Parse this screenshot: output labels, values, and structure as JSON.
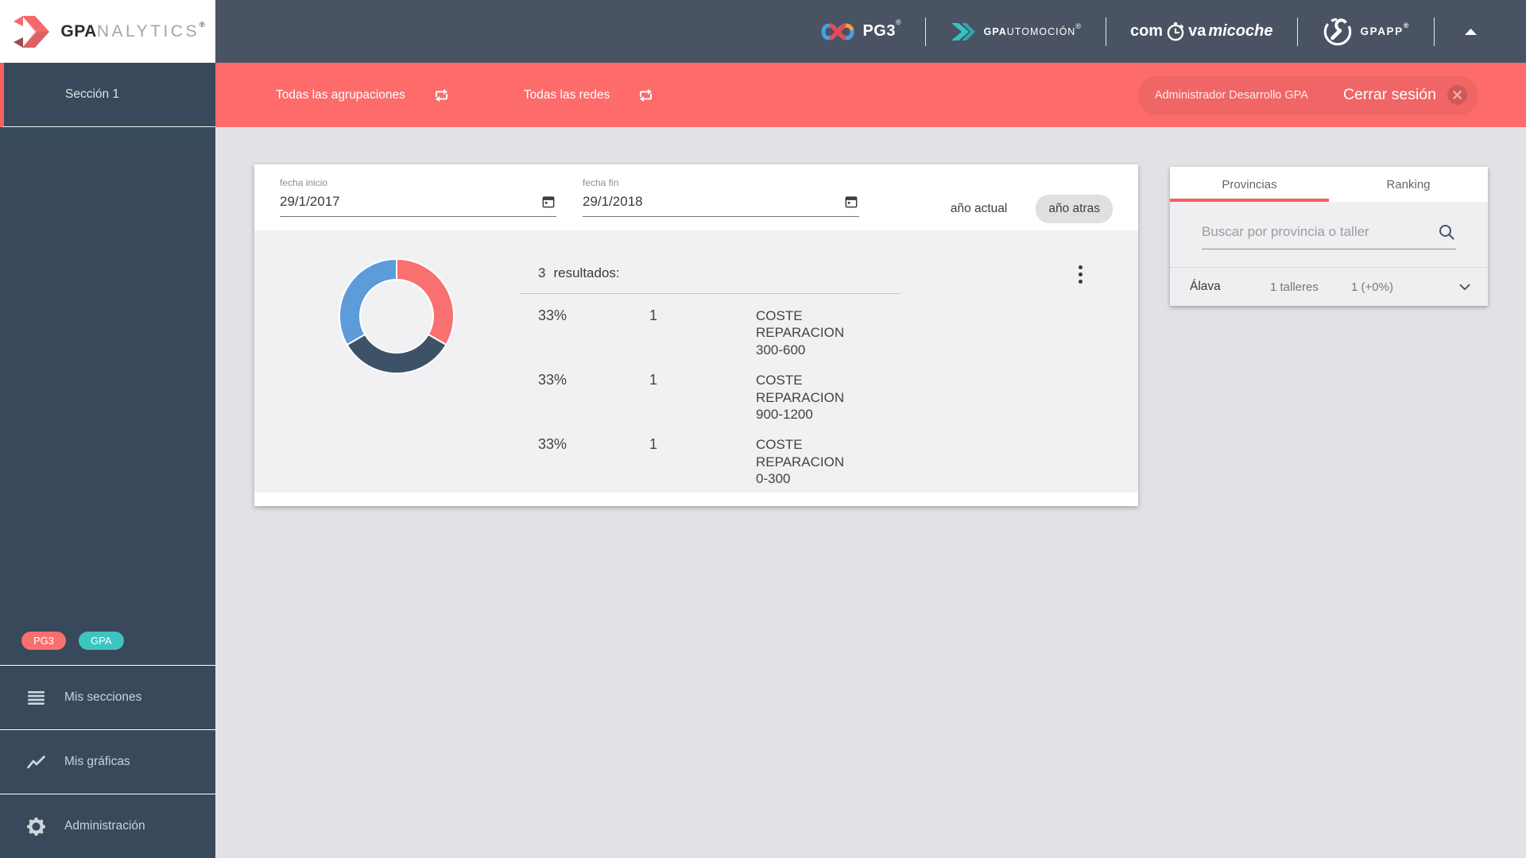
{
  "colors": {
    "accent_red": "#fe6b6b",
    "teal": "#3ec4c0",
    "header_bg": "#4a5363",
    "sidebar_bg": "#37495a",
    "tab_underline": "#f55f60"
  },
  "header": {
    "brand": {
      "gpa": "GPA",
      "nalytics": "NALYTICS",
      "reg": "®"
    },
    "pg3": {
      "label": "PG3",
      "reg": "®"
    },
    "gpautomocion": {
      "gpa": "GPA",
      "rest": "UTOMOCIÓN",
      "reg": "®"
    },
    "compravamicoche": {
      "part1": "com",
      "part2": "va",
      "part3": "micoche"
    },
    "gpapp": {
      "label": "GPAPP",
      "reg": "®"
    }
  },
  "sidebar": {
    "section": "Sección 1",
    "badges": [
      {
        "label": "PG3"
      },
      {
        "label": "GPA"
      }
    ],
    "items": [
      {
        "label": "Mis secciones"
      },
      {
        "label": "Mis gráficas"
      },
      {
        "label": "Administración"
      }
    ]
  },
  "toolbar": {
    "filters": [
      {
        "label": "Todas las agrupaciones"
      },
      {
        "label": "Todas las redes"
      }
    ],
    "user": "Administrador Desarrollo GPA",
    "logout": "Cerrar sesión"
  },
  "card": {
    "date_start": {
      "label": "fecha inicio",
      "value": "29/1/2017"
    },
    "date_end": {
      "label": "fecha fin",
      "value": "29/1/2018"
    },
    "year_current": "año actual",
    "year_back": "año atras",
    "results_count": "3",
    "results_label": "resultados:",
    "rows": [
      {
        "percent": "33%",
        "count": "1",
        "label": "COSTE REPARACION 300-600"
      },
      {
        "percent": "33%",
        "count": "1",
        "label": "COSTE REPARACION 900-1200"
      },
      {
        "percent": "33%",
        "count": "1",
        "label": "COSTE REPARACION 0-300"
      }
    ]
  },
  "panel": {
    "tabs": [
      {
        "label": "Provincias"
      },
      {
        "label": "Ranking"
      }
    ],
    "search_placeholder": "Buscar por provincia o taller",
    "rows": [
      {
        "name": "Álava",
        "talleres": "1 talleres",
        "value": "1 (+0%)"
      }
    ]
  },
  "chart_data": {
    "type": "pie",
    "donut": true,
    "title": "",
    "labels": [
      "COSTE REPARACION 300-600",
      "COSTE REPARACION 900-1200",
      "COSTE REPARACION 0-300"
    ],
    "values": [
      33.33,
      33.33,
      33.33
    ],
    "display_percents": [
      "33%",
      "33%",
      "33%"
    ],
    "counts": [
      1,
      1,
      1
    ],
    "colors": [
      "#f8706f",
      "#3d5266",
      "#5b9cd9"
    ],
    "start_angle_deg": -90,
    "legend_position": "none"
  }
}
